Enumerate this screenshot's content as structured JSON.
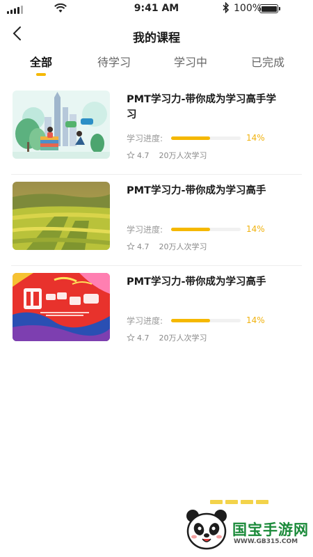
{
  "status_bar": {
    "time": "9:41 AM",
    "battery_pct": "100%"
  },
  "header": {
    "title": "我的课程",
    "back_icon": "chevron-left-icon"
  },
  "tabs": [
    {
      "label": "全部",
      "active": true
    },
    {
      "label": "待学习",
      "active": false
    },
    {
      "label": "学习中",
      "active": false
    },
    {
      "label": "已完成",
      "active": false
    }
  ],
  "courses": [
    {
      "title": "PMT学习力-带你成为学习高手学习",
      "progress_label": "学习进度:",
      "progress": 0.14,
      "progress_text": "14%",
      "rating": "4.7",
      "learners": "20万人次学习",
      "thumb": "city-illustration"
    },
    {
      "title": "PMT学习力-带你成为学习高手",
      "progress_label": "学习进度:",
      "progress": 0.14,
      "progress_text": "14%",
      "rating": "4.7",
      "learners": "20万人次学习",
      "thumb": "field-photo"
    },
    {
      "title": "PMT学习力-带你成为学习高手",
      "progress_label": "学习进度:",
      "progress": 0.14,
      "progress_text": "14%",
      "rating": "4.7",
      "learners": "20万人次学习",
      "thumb": "poster-banner"
    }
  ],
  "watermark": {
    "name": "国宝手游网",
    "url": "WWW.GB315.COM"
  },
  "colors": {
    "accent": "#f5b800",
    "progress_text": "#f0b20f",
    "tab_indicator": "#f5b800",
    "watermark_green": "#1b8a3a"
  }
}
